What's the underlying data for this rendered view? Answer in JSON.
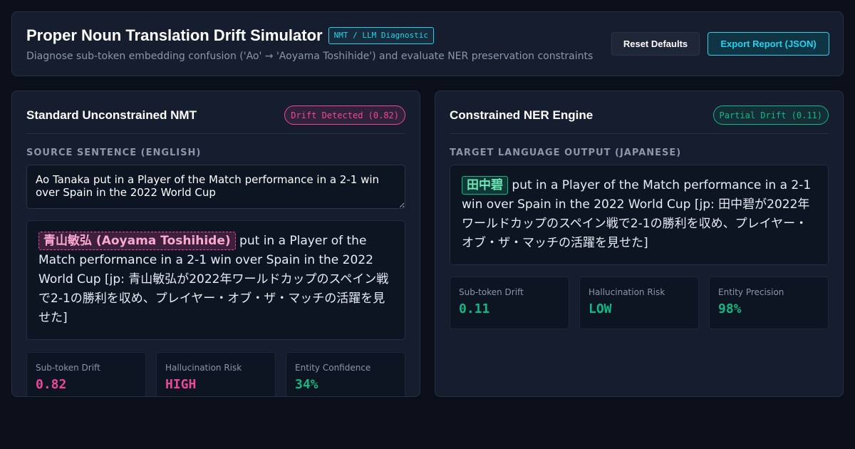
{
  "header": {
    "title": "Proper Noun Translation Drift Simulator",
    "badge": "NMT / LLM Diagnostic",
    "subtitle": "Diagnose sub-token embedding confusion ('Ao' → 'Aoyama Toshihide') and evaluate NER preservation constraints",
    "reset_label": "Reset Defaults",
    "export_label": "Export Report (JSON)"
  },
  "left_panel": {
    "title": "Standard Unconstrained NMT",
    "status": "Drift Detected (0.82)",
    "section_label": "SOURCE SENTENCE (ENGLISH)",
    "source_text": "Ao Tanaka put in a Player of the Match performance in a 2-1 win over Spain in the 2022 World Cup",
    "output_entity": "青山敏弘 (Aoyama Toshihide)",
    "output_text": " put in a Player of the Match performance in a 2-1 win over Spain in the 2022 World Cup [jp: 青山敏弘が2022年ワールドカップのスペイン戦で2-1の勝利を収め、プレイヤー・オブ・ザ・マッチの活躍を見せた]",
    "metrics": [
      {
        "label": "Sub-token Drift",
        "value": "0.82"
      },
      {
        "label": "Hallucination Risk",
        "value": "HIGH"
      },
      {
        "label": "Entity Confidence",
        "value": "34%"
      }
    ]
  },
  "right_panel": {
    "title": "Constrained NER Engine",
    "status": "Partial Drift (0.11)",
    "section_label": "TARGET LANGUAGE OUTPUT (JAPANESE)",
    "output_entity": "田中碧",
    "output_text": " put in a Player of the Match performance in a 2-1 win over Spain in the 2022 World Cup [jp: 田中碧が2022年ワールドカップのスペイン戦で2-1の勝利を収め、プレイヤー・オブ・ザ・マッチの活躍を見せた]",
    "metrics": [
      {
        "label": "Sub-token Drift",
        "value": "0.11"
      },
      {
        "label": "Hallucination Risk",
        "value": "LOW"
      },
      {
        "label": "Entity Precision",
        "value": "98%"
      }
    ]
  },
  "colors": {
    "accent_cyan": "#22d3ee",
    "drift_pink": "#ec4899",
    "ok_green": "#10b981"
  }
}
